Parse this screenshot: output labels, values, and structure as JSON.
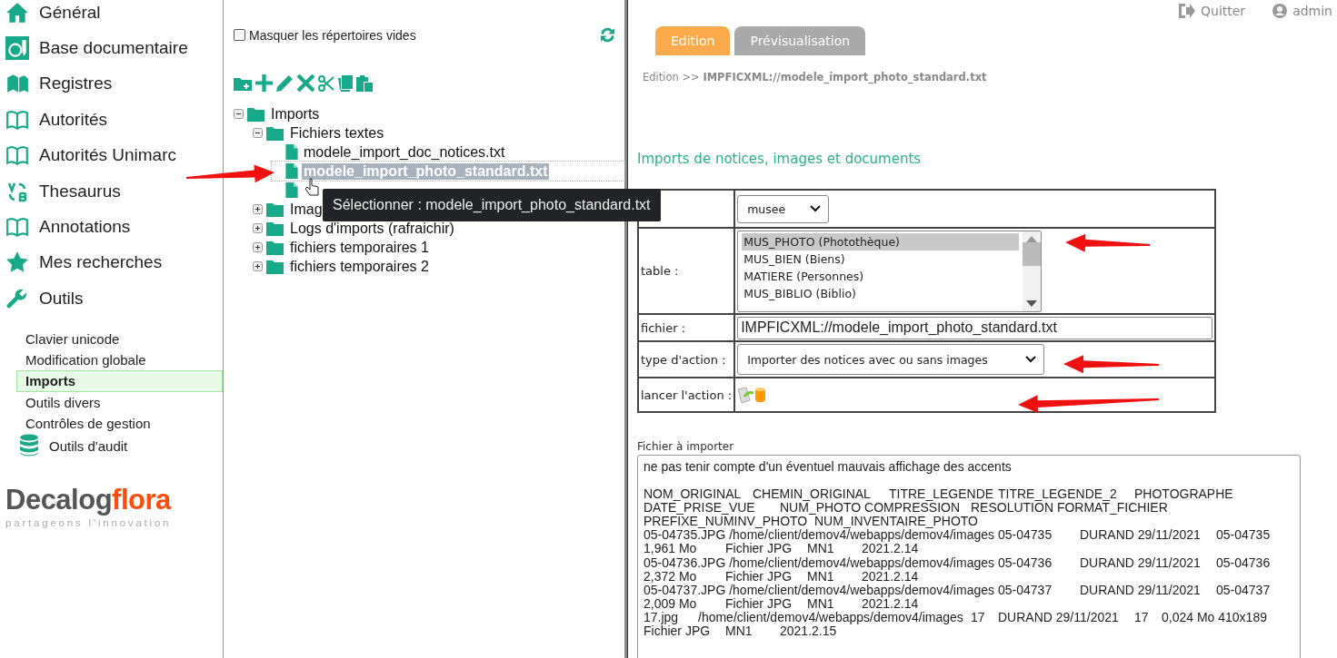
{
  "sidebar": {
    "items": [
      {
        "label": "Général"
      },
      {
        "label": "Base documentaire"
      },
      {
        "label": "Registres"
      },
      {
        "label": "Autorités"
      },
      {
        "label": "Autorités Unimarc"
      },
      {
        "label": "Thesaurus"
      },
      {
        "label": "Annotations"
      },
      {
        "label": "Mes recherches"
      },
      {
        "label": "Outils"
      }
    ],
    "subitems": [
      {
        "kind": "text",
        "label": "Clavier unicode",
        "selected": false
      },
      {
        "kind": "text",
        "label": "Modification globale",
        "selected": false
      },
      {
        "kind": "text",
        "label": "Imports",
        "selected": true
      },
      {
        "kind": "text",
        "label": "Outils divers",
        "selected": false
      },
      {
        "kind": "text",
        "label": "Contrôles de gestion",
        "selected": false
      },
      {
        "kind": "database",
        "label": "Outils d'audit",
        "selected": false
      }
    ],
    "logo": {
      "name": "Decalog",
      "accent": "flora",
      "tagline": "partageons l'innovation"
    }
  },
  "file_panel": {
    "hide_empty": {
      "label": "Masquer les répertoires vides",
      "checked": false
    },
    "tree": [
      {
        "kind": "folder",
        "label": "Imports",
        "expanded": true,
        "children": [
          {
            "kind": "folder",
            "label": "Fichiers textes",
            "expanded": true,
            "children": [
              {
                "kind": "file",
                "label": "modele_import_doc_notices.txt",
                "selected": false
              },
              {
                "kind": "file",
                "label": "modele_import_photo_standard.txt",
                "selected": true
              },
              {
                "kind": "file",
                "selected": false
              }
            ]
          },
          {
            "kind": "folder",
            "label": "Imag",
            "expanded": false
          },
          {
            "kind": "folder",
            "label": "Logs d'imports (rafraichir)",
            "expanded": false
          },
          {
            "kind": "folder",
            "label": "fichiers temporaires 1",
            "expanded": false
          },
          {
            "kind": "folder",
            "label": "fichiers temporaires 2",
            "expanded": false
          }
        ]
      }
    ],
    "tooltip": "Sélectionner : modele_import_photo_standard.txt"
  },
  "top_links": [
    {
      "kind": "logout",
      "label": "Quitter"
    },
    {
      "kind": "user",
      "label": "admin"
    }
  ],
  "editor": {
    "tabs": [
      {
        "label": "Edition",
        "selected": true
      },
      {
        "label": "Prévisualisation",
        "selected": false
      }
    ],
    "breadcrumb": "Edition >> **IMPFICXML://modele_import_photo_standard.txt**",
    "section_title": "Imports de notices, images et documents",
    "form": [
      {
        "kind": "select",
        "value": "musee"
      },
      {
        "kind": "listbox",
        "label": "table :",
        "options": [
          {
            "label": "MUS_PHOTO (Photothèque)",
            "selected": true
          },
          {
            "label": "MUS_BIEN (Biens)",
            "selected": false
          },
          {
            "label": "MATIERE (Personnes)",
            "selected": false
          },
          {
            "label": "MUS_BIBLIO (Biblio)",
            "selected": false
          }
        ]
      },
      {
        "kind": "input",
        "label": "fichier :",
        "value": "IMPFICXML://modele_import_photo_standard.txt"
      },
      {
        "kind": "select",
        "label": "type d'action :",
        "value": "Importer des notices avec ou sans images"
      },
      {
        "kind": "action",
        "label": "lancer l'action :"
      }
    ],
    "file_content": {
      "label": "Fichier à importer",
      "note": "ne pas tenir compte d'un éventuel mauvais affichage des accents",
      "lines": [
        "NOM_ORIGINAL\tCHEMIN_ORIGINAL\tTITRE_LEGENDE\tTITRE_LEGENDE_2\tPHOTOGRAPHE",
        "DATE_PRISE_VUE\tNUM_PHOTO COMPRESSION\tRESOLUTION FORMAT_FICHIER",
        "PREFIXE_NUMINV_PHOTO  NUM_INVENTAIRE_PHOTO",
        "05-04735.JPG /home/client/demov4/webapps/demov4/images\t05-04735\tDURAND 29/11/2021\t05-04735",
        "1,961 Mo\tFichier JPG\tMN1\t2021.2.14",
        "05-04736.JPG /home/client/demov4/webapps/demov4/images\t05-04736\tDURAND 29/11/2021\t05-04736",
        "2,372 Mo\tFichier JPG\tMN1\t2021.2.14",
        "05-04737.JPG /home/client/demov4/webapps/demov4/images\t05-04737\tDURAND 29/11/2021\t05-04737",
        "2,009 Mo\tFichier JPG\tMN1\t2021.2.14",
        "17.jpg\t/home/client/demov4/webapps/demov4/images\t17\tDURAND 29/11/2021\t17\t0,024 Mo 410x189",
        "Fichier JPG\tMN1\t2021.2.15"
      ]
    }
  }
}
